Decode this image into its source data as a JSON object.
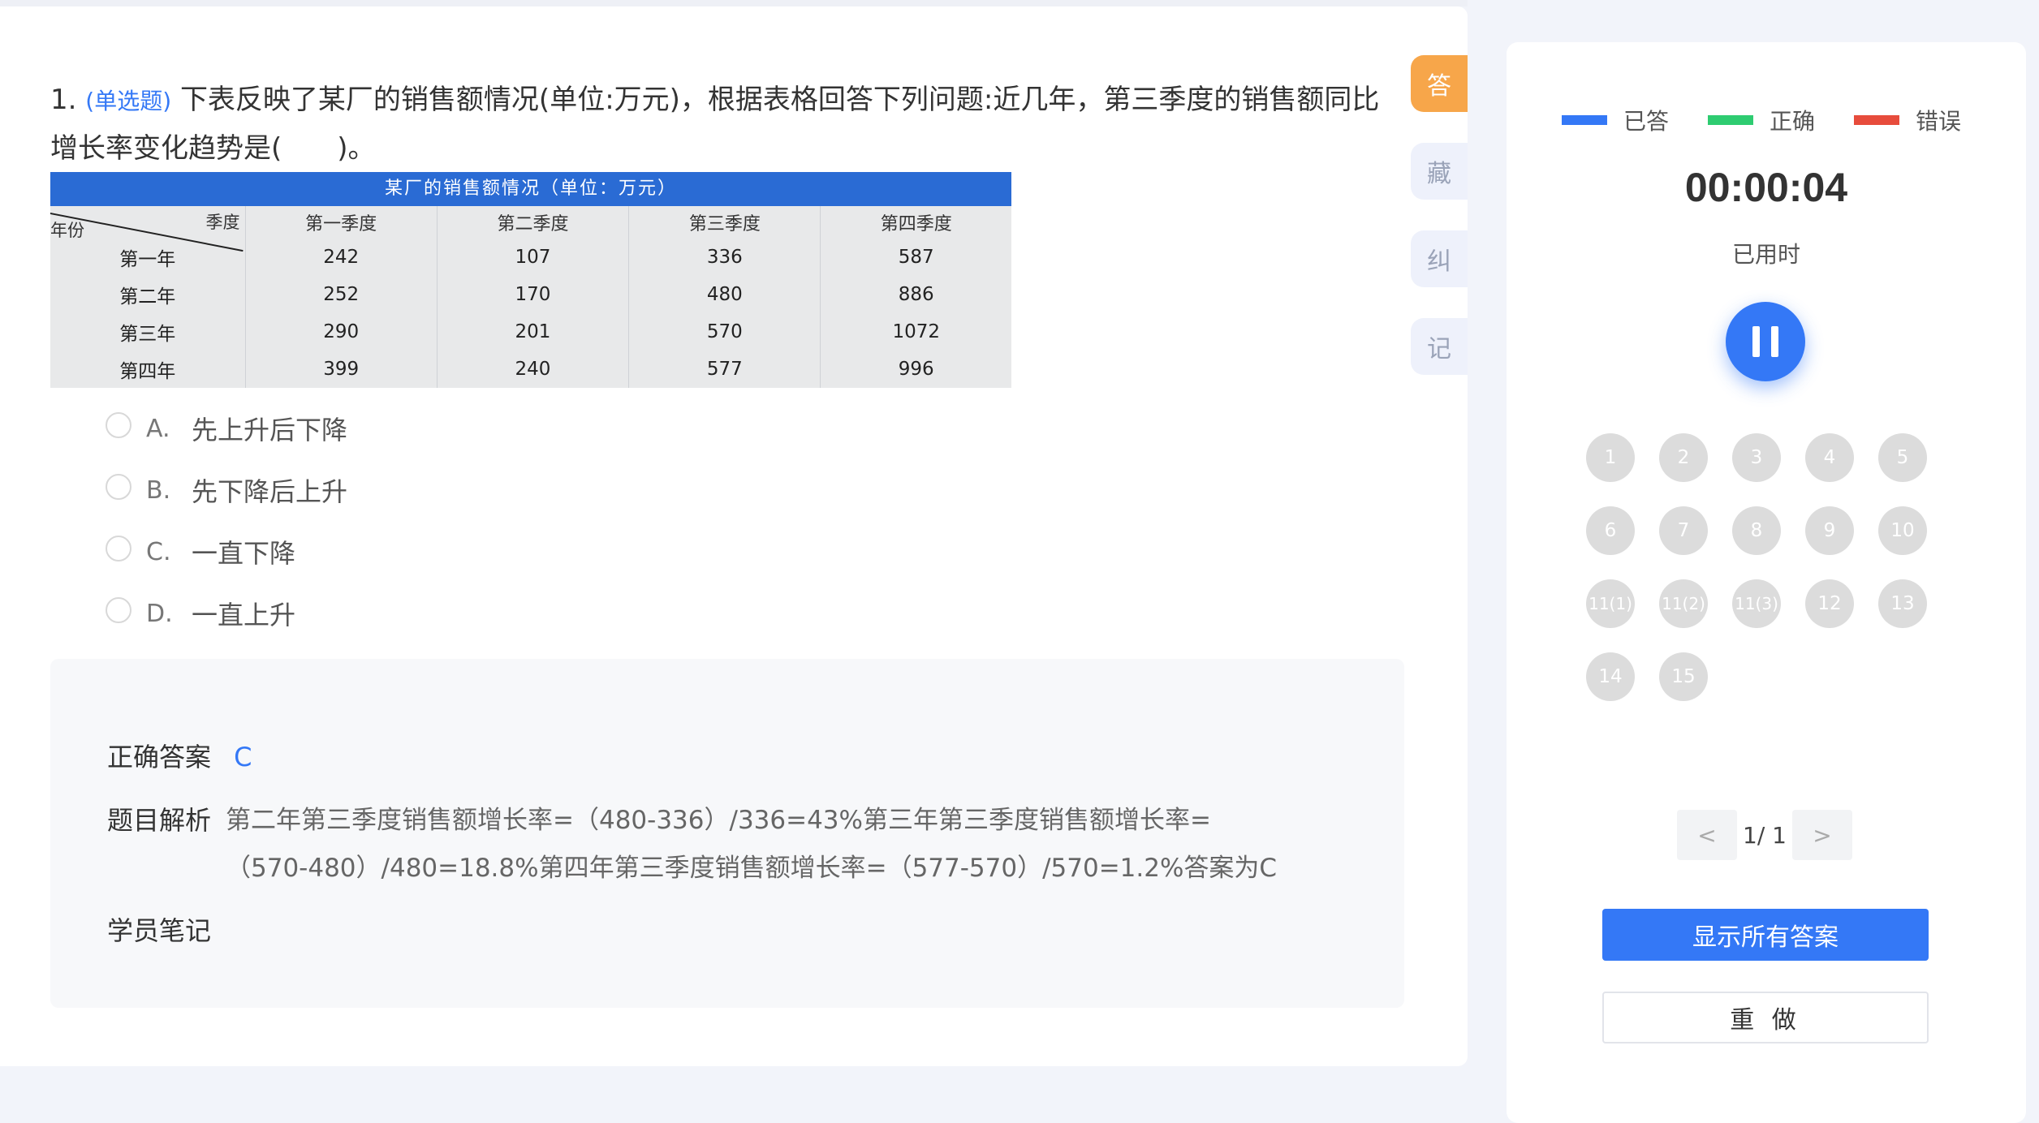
{
  "question": {
    "number": "1.",
    "type": "(单选题)",
    "text": "下表反映了某厂的销售额情况(单位:万元)，根据表格回答下列问题:近几年，第三季度的销售额同比增长率变化趋势是(　　)。"
  },
  "table": {
    "title": "某厂的销售额情况（单位：万元）",
    "corner_year": "年份",
    "corner_season": "季度",
    "headers": [
      "第一季度",
      "第二季度",
      "第三季度",
      "第四季度"
    ],
    "rows": [
      {
        "label": "第一年",
        "values": [
          "242",
          "107",
          "336",
          "587"
        ]
      },
      {
        "label": "第二年",
        "values": [
          "252",
          "170",
          "480",
          "886"
        ]
      },
      {
        "label": "第三年",
        "values": [
          "290",
          "201",
          "570",
          "1072"
        ]
      },
      {
        "label": "第四年",
        "values": [
          "399",
          "240",
          "577",
          "996"
        ]
      }
    ]
  },
  "options": [
    {
      "letter": "A.",
      "text": "先上升后下降"
    },
    {
      "letter": "B.",
      "text": "先下降后上升"
    },
    {
      "letter": "C.",
      "text": "一直下降"
    },
    {
      "letter": "D.",
      "text": "一直上升"
    }
  ],
  "answer": {
    "correct_label": "正确答案",
    "correct_value": "C",
    "analysis_label": "题目解析",
    "analysis_text": "第二年第三季度销售额增长率=（480-336）/336=43%第三年第三季度销售额增长率=（570-480）/480=18.8%第四年第三季度销售额增长率=（577-570）/570=1.2%答案为C",
    "notes_label": "学员笔记"
  },
  "side_buttons": [
    "答",
    "藏",
    "纠",
    "记"
  ],
  "legend": [
    {
      "label": "已答",
      "color": "#3478f6"
    },
    {
      "label": "正确",
      "color": "#2ecc71"
    },
    {
      "label": "错误",
      "color": "#e74c3c"
    }
  ],
  "timer": {
    "value": "00:00:04",
    "label": "已用时"
  },
  "question_numbers": [
    "1",
    "2",
    "3",
    "4",
    "5",
    "6",
    "7",
    "8",
    "9",
    "10",
    "11(1)",
    "11(2)",
    "11(3)",
    "12",
    "13",
    "14",
    "15"
  ],
  "pager": {
    "prev": "<",
    "text": "1/ 1",
    "next": ">"
  },
  "buttons": {
    "show_all": "显示所有答案",
    "redo": "重 做"
  }
}
